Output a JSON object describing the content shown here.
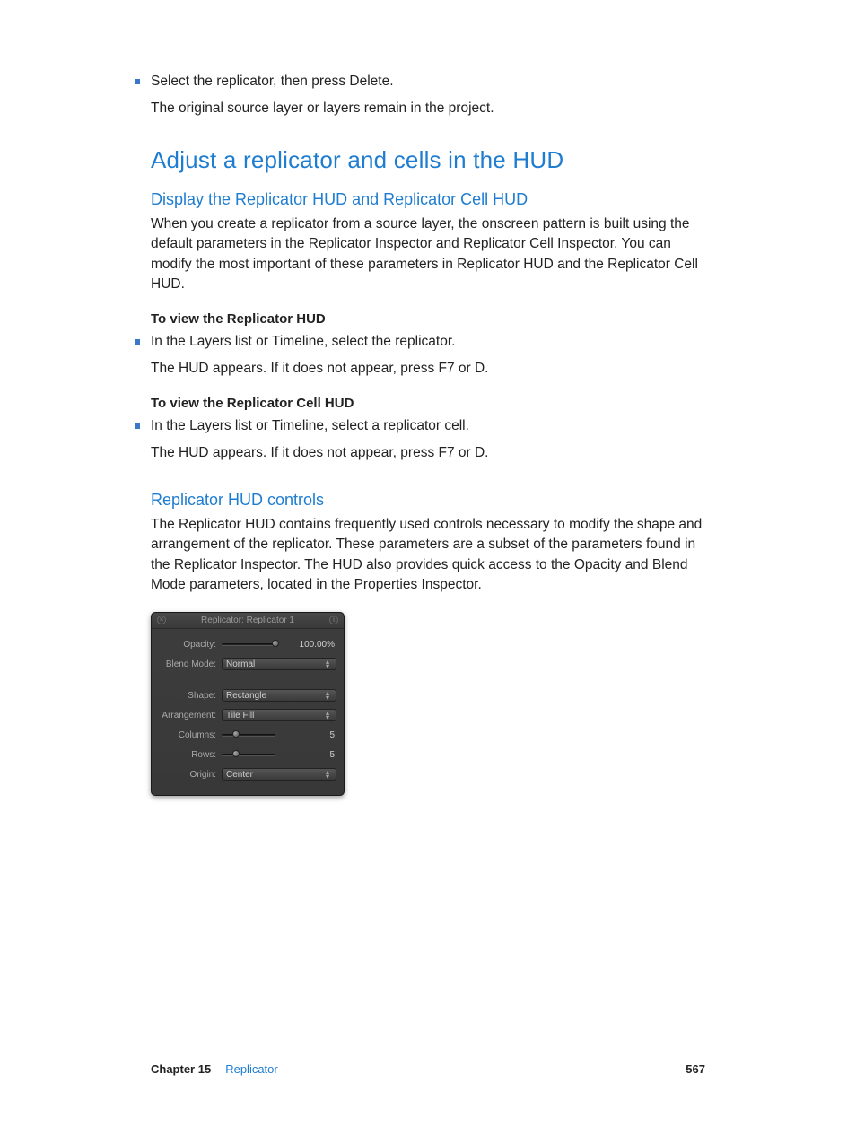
{
  "intro": {
    "bullet1": "Select the replicator, then press Delete.",
    "after1": "The original source layer or layers remain in the project."
  },
  "h1": "Adjust a replicator and cells in the HUD",
  "sectionA": {
    "heading": "Display the Replicator HUD and Replicator Cell HUD",
    "para": "When you create a replicator from a source layer, the onscreen pattern is built using the default parameters in the Replicator Inspector and Replicator Cell Inspector. You can modify the most important of these parameters in Replicator HUD and the Replicator Cell HUD.",
    "sub1_title": "To view the Replicator HUD",
    "sub1_bullet": "In the Layers list or Timeline, select the replicator.",
    "sub1_after": "The HUD appears. If it does not appear, press F7 or D.",
    "sub2_title": "To view the Replicator Cell HUD",
    "sub2_bullet": "In the Layers list or Timeline, select a replicator cell.",
    "sub2_after": "The HUD appears. If it does not appear, press F7 or D."
  },
  "sectionB": {
    "heading": "Replicator HUD controls",
    "para": "The Replicator HUD contains frequently used controls necessary to modify the shape and arrangement of the replicator. These parameters are a subset of the parameters found in the Replicator Inspector. The HUD also provides quick access to the Opacity and Blend Mode parameters, located in the Properties Inspector."
  },
  "hud": {
    "title": "Replicator: Replicator 1",
    "rows": {
      "opacity_label": "Opacity:",
      "opacity_value": "100.00%",
      "blend_label": "Blend Mode:",
      "blend_value": "Normal",
      "shape_label": "Shape:",
      "shape_value": "Rectangle",
      "arrangement_label": "Arrangement:",
      "arrangement_value": "Tile Fill",
      "columns_label": "Columns:",
      "columns_value": "5",
      "rows_label": "Rows:",
      "rows_value": "5",
      "origin_label": "Origin:",
      "origin_value": "Center"
    }
  },
  "footer": {
    "chapter": "Chapter 15",
    "title": "Replicator",
    "page": "567"
  }
}
